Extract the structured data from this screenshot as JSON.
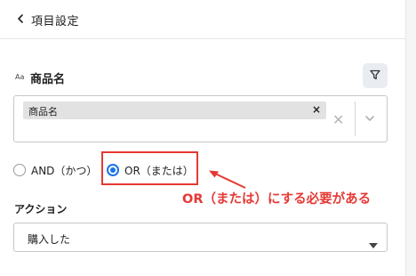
{
  "header": {
    "title": "項目設定",
    "back_icon": "chevron-left-icon"
  },
  "field": {
    "type_badge": "Aa",
    "name": "商品名",
    "filter_icon": "filter-funnel-icon"
  },
  "multiselect": {
    "selected_tags": [
      {
        "label": "商品名",
        "remove": "×"
      }
    ],
    "clear_symbol": "✕",
    "chevron_icon": "chevron-down-icon"
  },
  "logic": {
    "options": [
      {
        "label": "AND（かつ）",
        "selected": false
      },
      {
        "label": "OR（または）",
        "selected": true
      }
    ]
  },
  "annotation": {
    "text": "OR（または）にする必要がある",
    "color": "#e53935"
  },
  "action": {
    "label": "アクション",
    "selected_value": "購入した"
  },
  "colors": {
    "accent": "#1a73e8",
    "annotation_red": "#e53935"
  }
}
